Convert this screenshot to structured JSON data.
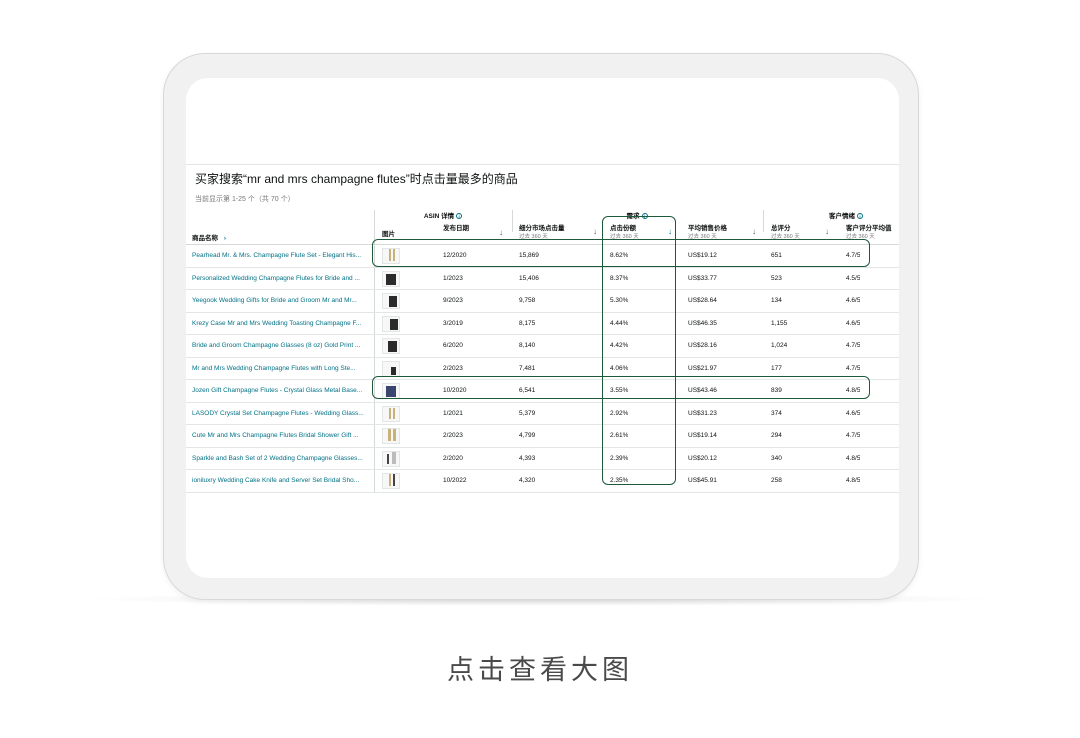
{
  "report": {
    "title": "买家搜索“mr and mrs champagne flutes”时点击量最多的商品",
    "subtitle": "当前显示第 1-25 个（共 70 个）"
  },
  "groups": {
    "asin": "ASIN 详情",
    "demand": "需求",
    "sentiment": "客户情绪"
  },
  "columns": {
    "name": "商品名称",
    "image": "图片",
    "date": "发布日期",
    "clicks": "细分市场点击量",
    "clicks_sub": "过去 360 天",
    "share": "点击份额",
    "share_sub": "过去 360 天",
    "price": "平均销售价格",
    "price_sub": "过去 360 天",
    "ratings": "总评分",
    "ratings_sub": "过去 360 天",
    "avg": "客户评分平均值",
    "avg_sub": "过去 360 天"
  },
  "rows": [
    {
      "name": "Pearhead Mr. & Mrs. Champagne Flute Set - Elegant His...",
      "date": "12/2020",
      "clicks": "15,869",
      "share": "8.62%",
      "price": "US$19.12",
      "ratings": "651",
      "avg": "4.7/5"
    },
    {
      "name": "Personalized Wedding Champagne Flutes for Bride and ...",
      "date": "1/2023",
      "clicks": "15,406",
      "share": "8.37%",
      "price": "US$33.77",
      "ratings": "523",
      "avg": "4.5/5"
    },
    {
      "name": "Yeegook Wedding Gifts for Bride and Groom Mr and Mr...",
      "date": "9/2023",
      "clicks": "9,758",
      "share": "5.30%",
      "price": "US$28.64",
      "ratings": "134",
      "avg": "4.6/5"
    },
    {
      "name": "Krezy Case Mr and Mrs Wedding Toasting Champagne F...",
      "date": "3/2019",
      "clicks": "8,175",
      "share": "4.44%",
      "price": "US$46.35",
      "ratings": "1,155",
      "avg": "4.6/5"
    },
    {
      "name": "Bride and Groom Champagne Glasses (8 oz) Gold Print ...",
      "date": "6/2020",
      "clicks": "8,140",
      "share": "4.42%",
      "price": "US$28.16",
      "ratings": "1,024",
      "avg": "4.7/5"
    },
    {
      "name": "Mr and Mrs Wedding Champagne Flutes with Long Ste...",
      "date": "2/2023",
      "clicks": "7,481",
      "share": "4.06%",
      "price": "US$21.97",
      "ratings": "177",
      "avg": "4.7/5"
    },
    {
      "name": "Jozen Gift Champagne Flutes - Crystal Glass Metal Base...",
      "date": "10/2020",
      "clicks": "6,541",
      "share": "3.55%",
      "price": "US$43.46",
      "ratings": "839",
      "avg": "4.8/5"
    },
    {
      "name": "LASODY Crystal Set Champagne Flutes - Wedding Glass...",
      "date": "1/2021",
      "clicks": "5,379",
      "share": "2.92%",
      "price": "US$31.23",
      "ratings": "374",
      "avg": "4.6/5"
    },
    {
      "name": "Cute Mr and Mrs Champagne Flutes Bridal Shower Gift ...",
      "date": "2/2023",
      "clicks": "4,799",
      "share": "2.61%",
      "price": "US$19.14",
      "ratings": "294",
      "avg": "4.7/5"
    },
    {
      "name": "Sparkle and Bash Set of 2 Wedding Champagne Glasses...",
      "date": "2/2020",
      "clicks": "4,393",
      "share": "2.39%",
      "price": "US$20.12",
      "ratings": "340",
      "avg": "4.8/5"
    },
    {
      "name": "ioniluxry Wedding Cake Knife and Server Set Bridal Sho...",
      "date": "10/2022",
      "clicks": "4,320",
      "share": "2.35%",
      "price": "US$45.91",
      "ratings": "258",
      "avg": "4.8/5"
    }
  ],
  "caption": "点击查看大图",
  "colors": {
    "highlight": "#1e5a3a",
    "link": "#007185"
  }
}
